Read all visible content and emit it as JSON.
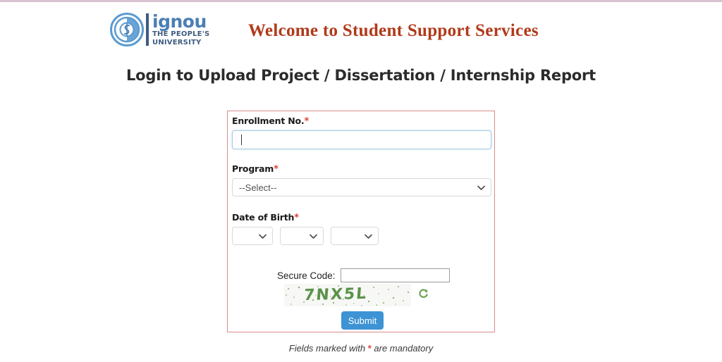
{
  "header": {
    "logo": {
      "name": "ignou",
      "tagline_line1": "THE PEOPLE'S",
      "tagline_line2": "UNIVERSITY",
      "emblem_icon": "ignou-emblem-icon",
      "color": "#4a7fb5"
    },
    "site_title": "Welcome to Student Support Services",
    "site_title_color": "#b03a1a"
  },
  "page": {
    "heading": "Login to Upload Project / Dissertation / Internship Report"
  },
  "form": {
    "border_color": "#d88b8b",
    "required_marker": "*",
    "required_color": "#e0413b",
    "fields": {
      "enrollment": {
        "label": "Enrollment No.",
        "value": "",
        "placeholder": "",
        "focused": true
      },
      "program": {
        "label": "Program",
        "selected": "--Select--",
        "chevron_icon": "chevron-down-icon"
      },
      "dob": {
        "label": "Date of Birth",
        "day": "",
        "month": "",
        "year": "",
        "chevron_icon": "chevron-down-icon"
      }
    },
    "captcha": {
      "label": "Secure Code:",
      "input_value": "",
      "code_text": "7NX5L",
      "code_color": "#4f8a3e",
      "refresh_icon": "refresh-icon"
    },
    "submit_label": "Submit",
    "submit_color": "#3d93d4"
  },
  "footer": {
    "note_prefix": "Fields marked with ",
    "note_marker": "*",
    "note_suffix": " are mandatory"
  }
}
